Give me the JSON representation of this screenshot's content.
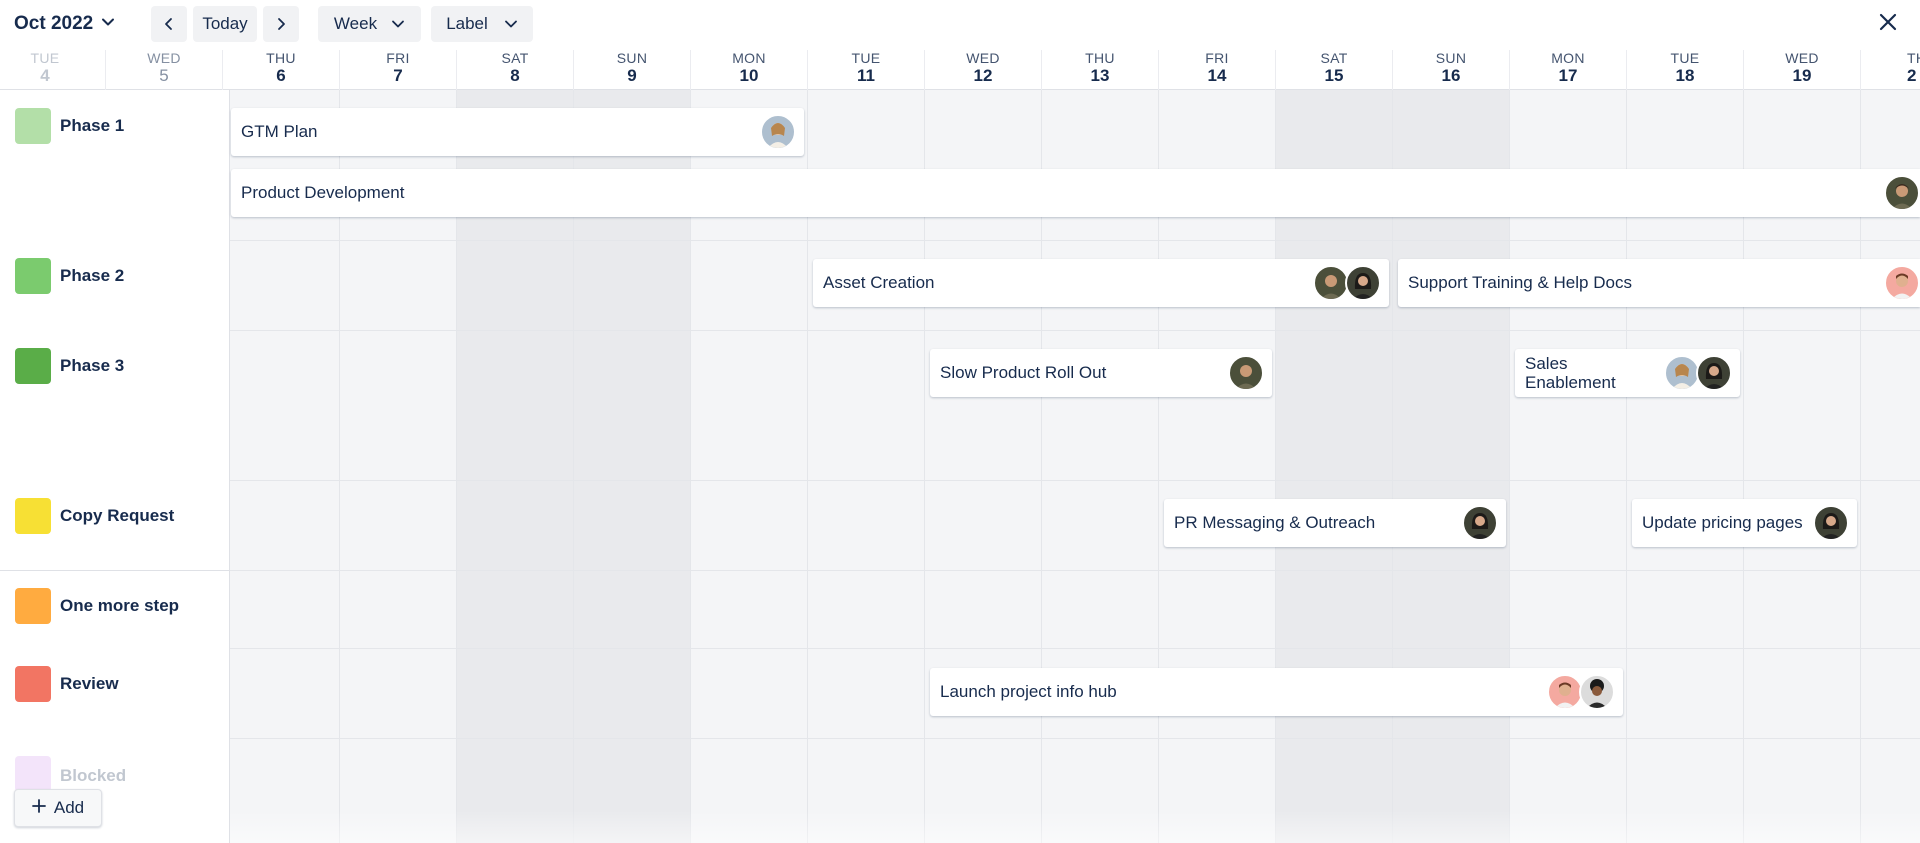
{
  "toolbar": {
    "month_label": "Oct 2022",
    "today_label": "Today",
    "view_label": "Week",
    "group_label": "Label"
  },
  "days": [
    {
      "name": "TUE",
      "date": "4"
    },
    {
      "name": "WED",
      "date": "5"
    },
    {
      "name": "THU",
      "date": "6"
    },
    {
      "name": "FRI",
      "date": "7"
    },
    {
      "name": "SAT",
      "date": "8"
    },
    {
      "name": "SUN",
      "date": "9"
    },
    {
      "name": "MON",
      "date": "10"
    },
    {
      "name": "TUE",
      "date": "11"
    },
    {
      "name": "WED",
      "date": "12"
    },
    {
      "name": "THU",
      "date": "13"
    },
    {
      "name": "FRI",
      "date": "14"
    },
    {
      "name": "SAT",
      "date": "15"
    },
    {
      "name": "SUN",
      "date": "16"
    },
    {
      "name": "MON",
      "date": "17"
    },
    {
      "name": "TUE",
      "date": "18"
    },
    {
      "name": "WED",
      "date": "19"
    },
    {
      "name": "TH",
      "date": "2"
    }
  ],
  "labels": [
    {
      "name": "Phase 1",
      "color": "#b3dfa8"
    },
    {
      "name": "Phase 2",
      "color": "#7bcb6e"
    },
    {
      "name": "Phase 3",
      "color": "#5aad48"
    },
    {
      "name": "Copy Request",
      "color": "#f7e034"
    },
    {
      "name": "One more step",
      "color": "#ffab40"
    },
    {
      "name": "Review",
      "color": "#f27563"
    },
    {
      "name": "Blocked",
      "color": "#e8c9f5"
    }
  ],
  "add_label": "Add",
  "events": [
    {
      "title": "GTM Plan",
      "avatars": [
        "woman-light"
      ]
    },
    {
      "title": "Product Development",
      "avatars": [
        "man-dark"
      ]
    },
    {
      "title": "Asset Creation",
      "avatars": [
        "man-dark",
        "woman-dark"
      ]
    },
    {
      "title": "Support Training & Help Docs",
      "avatars": [
        "man-pink"
      ]
    },
    {
      "title": "Slow Product Roll Out",
      "avatars": [
        "man-dark"
      ]
    },
    {
      "title": "Sales Enablement",
      "avatars": [
        "woman-light",
        "woman-dark"
      ]
    },
    {
      "title": "PR Messaging & Outreach",
      "avatars": [
        "woman-dark"
      ]
    },
    {
      "title": "Update pricing pages",
      "avatars": [
        "woman-dark"
      ]
    },
    {
      "title": "Launch project info hub",
      "avatars": [
        "man-pink",
        "man-curly"
      ]
    }
  ],
  "icons": {
    "month_dropdown": "chevron-down-icon",
    "prev": "chevron-left-icon",
    "next": "chevron-right-icon",
    "view_dropdown": "chevron-down-icon",
    "group_dropdown": "chevron-down-icon",
    "close": "close-icon",
    "add": "plus-icon"
  }
}
